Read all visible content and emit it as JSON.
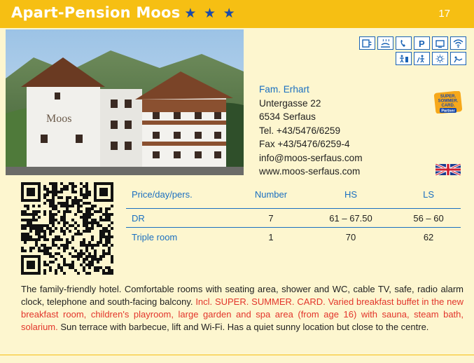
{
  "header": {
    "title": "Apart-Pension Moos",
    "stars": "★ ★ ★",
    "page_number": "17"
  },
  "photo": {
    "sign_text": "Moos"
  },
  "amenity_icons": [
    "elevator-icon",
    "sauna-icon",
    "telephone-icon",
    "parking-icon",
    "tv-icon",
    "wifi-icon",
    "playground-icon",
    "kids-icon",
    "sunbed-icon",
    "garden-icon"
  ],
  "contact": {
    "name": "Fam. Erhart",
    "street": "Untergasse 22",
    "city": "6534 Serfaus",
    "tel": "Tel. +43/5476/6259",
    "fax": "Fax +43/5476/6259-4",
    "email": "info@moos-serfaus.com",
    "web": "www.moos-serfaus.com"
  },
  "badge": {
    "line1": "SUPER.",
    "line2": "SOMMER.",
    "line3": "CARD.",
    "line4": "Partner"
  },
  "prices": {
    "headers": [
      "Price/day/pers.",
      "Number",
      "HS",
      "LS"
    ],
    "rows": [
      {
        "room": "DR",
        "number": "7",
        "hs": "61 – 67.50",
        "ls": "56 – 60"
      },
      {
        "room": "Triple room",
        "number": "1",
        "hs": "70",
        "ls": "62"
      }
    ]
  },
  "description": {
    "part1": " The family-friendly hotel. Comfortable rooms with seating area, shower and WC, cable TV, safe, radio alarm clock, telephone and south-facing balcony. ",
    "highlight": "Incl. SUPER. SUMMER. CARD. Varied breakfast buffet in the new breakfast room, children's playroom, large garden and spa area (from age 16) with sauna, steam bath, solarium.",
    "part2": " Sun terrace with barbecue, lift and Wi-Fi. Has a quiet sunny location but close to the centre."
  },
  "colors": {
    "header_bg": "#f6bf13",
    "page_bg": "#fdf6cf",
    "accent_blue": "#1a6fc0",
    "star_blue": "#1a4aa8",
    "highlight_red": "#e2352b"
  }
}
